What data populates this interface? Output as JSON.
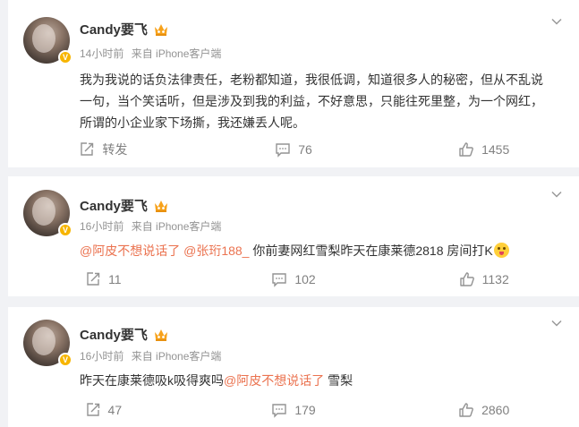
{
  "posts": [
    {
      "name": "Candy要飞",
      "time": "14小时前",
      "source": "来自 iPhone客户端",
      "content": [
        {
          "type": "text",
          "text": "我为我说的话负法律责任，老粉都知道，我很低调，知道很多人的秘密，但从不乱说一句，当个笑话听，但是涉及到我的利益，不好意思，只能往死里整，为一个网红，所谓的小企业家下场撕，我还嫌丢人呢。"
        }
      ],
      "repost": "转发",
      "comments": "76",
      "likes": "1455"
    },
    {
      "name": "Candy要飞",
      "time": "16小时前",
      "source": "来自 iPhone客户端",
      "content": [
        {
          "type": "mention",
          "text": "@阿皮不想说话了"
        },
        {
          "type": "text",
          "text": " "
        },
        {
          "type": "mention",
          "text": "@张珩188_"
        },
        {
          "type": "text",
          "text": " 你前妻网红雪梨昨天在康莱德2818 房间打K"
        }
      ],
      "repost": "11",
      "comments": "102",
      "likes": "1132"
    },
    {
      "name": "Candy要飞",
      "time": "16小时前",
      "source": "来自 iPhone客户端",
      "content": [
        {
          "type": "text",
          "text": "昨天在康莱德吸k吸得爽吗"
        },
        {
          "type": "mention",
          "text": "@阿皮不想说话了"
        },
        {
          "type": "text",
          "text": " 雪梨"
        }
      ],
      "repost": "47",
      "comments": "179",
      "likes": "2860"
    }
  ],
  "colors": {
    "mention": "#eb7350",
    "verified": "#f7b500",
    "background": "#f1f2f5"
  },
  "icons": [
    "chevron-down-icon",
    "crown-icon",
    "verified-icon",
    "repost-icon",
    "comment-icon",
    "like-icon",
    "tongue-emoji-icon"
  ]
}
